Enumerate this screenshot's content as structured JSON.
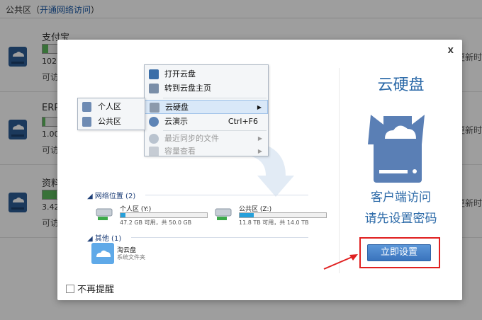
{
  "background": {
    "header_prefix": "公共区（",
    "header_link": "开通网络访问",
    "header_suffix": "）",
    "rows": [
      {
        "name": "支付宝",
        "size": "102",
        "action": "可访",
        "update": "更新时"
      },
      {
        "name": "ERP",
        "size": "1.00",
        "action": "可访",
        "update": "更新时"
      },
      {
        "name": "资料",
        "size": "3.42",
        "action": "可访",
        "update": "更新时"
      }
    ]
  },
  "modal": {
    "close_label": "x",
    "context_menu": {
      "items": [
        {
          "label": "打开云盘",
          "icon": "folder-icon"
        },
        {
          "label": "转到云盘主页",
          "icon": "home-icon"
        },
        {
          "label": "云硬盘",
          "icon": "drive-icon",
          "submenu_arrow": "▶"
        },
        {
          "label": "云演示",
          "icon": "presentation-icon",
          "shortcut": "Ctrl+F6"
        },
        {
          "label": "最近同步的文件",
          "icon": "clock-icon",
          "submenu_arrow": "▶"
        },
        {
          "label": "容量查看",
          "icon": "capacity-icon",
          "submenu_arrow": "▶"
        }
      ],
      "submenu": [
        {
          "label": "个人区",
          "icon": "user-icon"
        },
        {
          "label": "公共区",
          "icon": "group-icon"
        }
      ]
    },
    "explorer": {
      "network_section": "网络位置 (2)",
      "drives": [
        {
          "name": "个人区 (Y:)",
          "size": "47.2 GB 可用，共 50.0 GB",
          "used_fraction": 0.06
        },
        {
          "name": "公共区 (Z:)",
          "size": "11.8 TB 可用，共 14.0 TB",
          "used_fraction": 0.16
        }
      ],
      "other_section": "其他 (1)",
      "app": {
        "name": "淘云盘",
        "desc": "系统文件夹"
      }
    },
    "product_title": "云硬盘",
    "message_line1": "客户端访问",
    "message_line2": "请先设置密码",
    "setup_button": "立即设置",
    "dont_remind": "不再提醒",
    "colors": {
      "accent": "#2c6aa8",
      "highlight": "#e02020"
    }
  }
}
